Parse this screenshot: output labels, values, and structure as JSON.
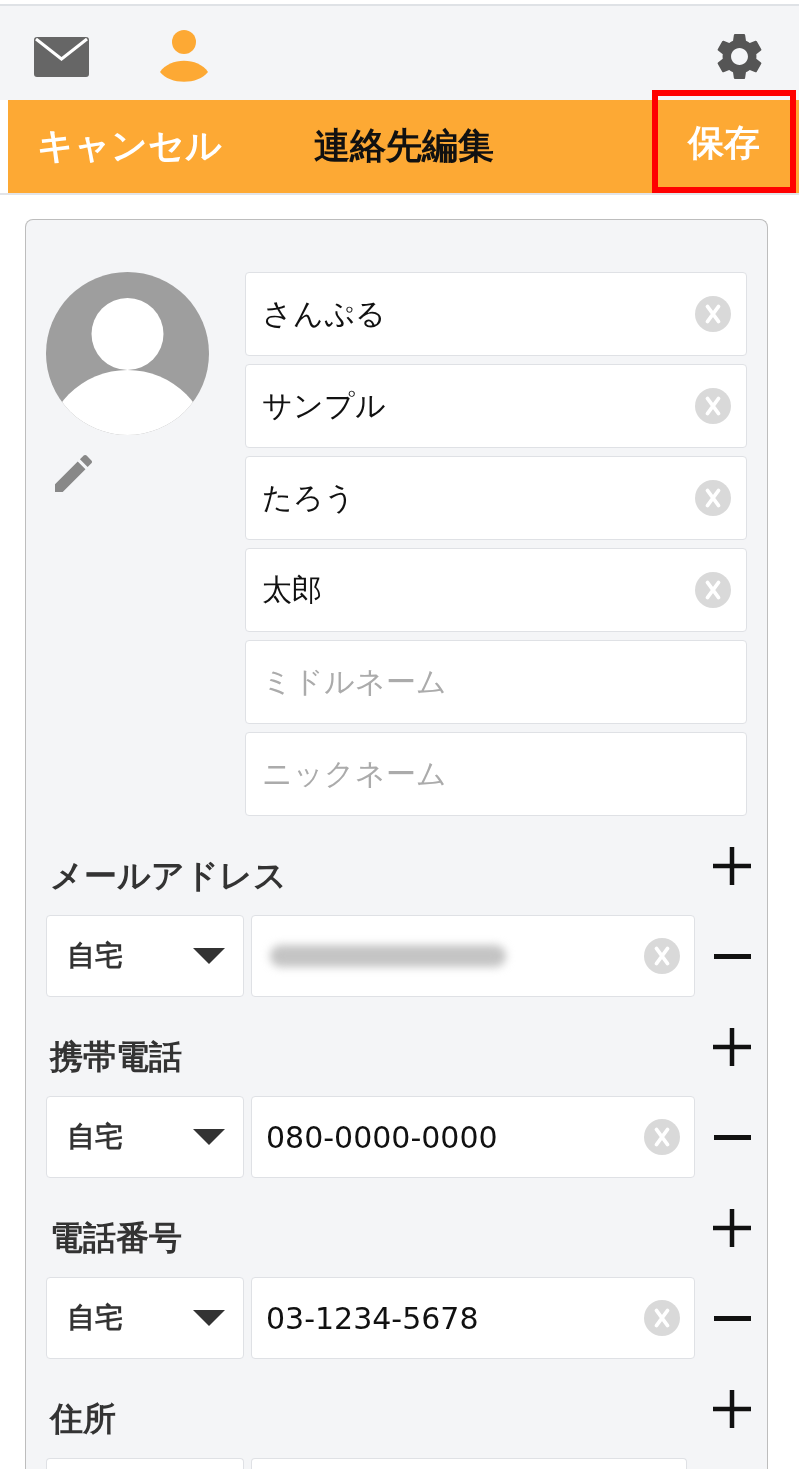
{
  "nav_tabs": [
    {
      "kind": "mail",
      "selected": false
    },
    {
      "kind": "contacts",
      "selected": true
    }
  ],
  "title_bar": {
    "cancel": "キャンセル",
    "title": "連絡先編集",
    "save": {
      "label": "保存",
      "highlighted": true
    }
  },
  "name_fields": [
    {
      "value": "さんぷる"
    },
    {
      "value": "サンプル"
    },
    {
      "value": "たろう"
    },
    {
      "value": "太郎"
    },
    {
      "placeholder": "ミドルネーム"
    },
    {
      "placeholder": "ニックネーム"
    }
  ],
  "sections": [
    {
      "label": "メールアドレス",
      "entries": [
        {
          "type": "自宅",
          "redacted": true
        }
      ]
    },
    {
      "label": "携帯電話",
      "entries": [
        {
          "type": "自宅",
          "value": "080-0000-0000"
        }
      ]
    },
    {
      "label": "電話番号",
      "entries": [
        {
          "type": "自宅",
          "value": "03-1234-5678"
        }
      ]
    },
    {
      "label": "住所",
      "entries": [
        {
          "cut_off": true
        }
      ]
    }
  ]
}
